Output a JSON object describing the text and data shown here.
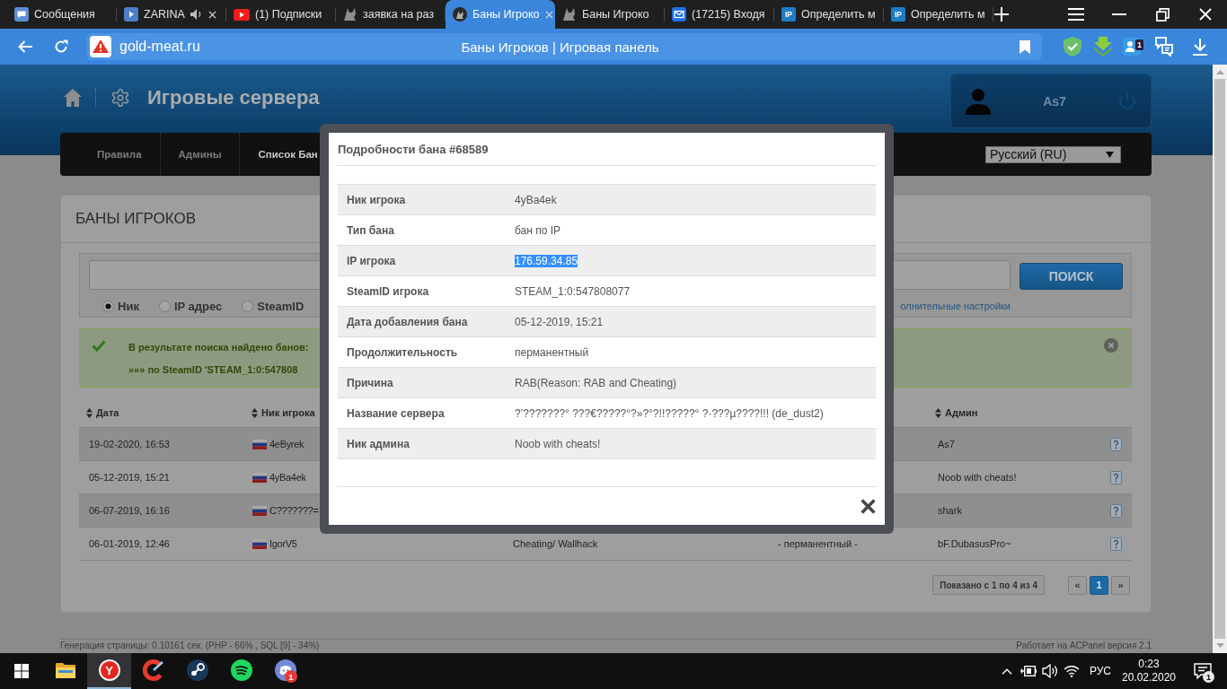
{
  "browser": {
    "tabs": [
      {
        "title": "Сообщения",
        "selected": false,
        "audio": false,
        "closable": false
      },
      {
        "title": "ZARINA",
        "selected": false,
        "audio": true,
        "closable": true
      },
      {
        "title": "(1) Подписки",
        "selected": false,
        "audio": false,
        "closable": false
      },
      {
        "title": "заявка на раз",
        "selected": false,
        "audio": false,
        "closable": false
      },
      {
        "title": "Баны Игроко",
        "selected": true,
        "audio": false,
        "closable": true
      },
      {
        "title": "Баны Игроко",
        "selected": false,
        "audio": false,
        "closable": false
      },
      {
        "title": "(17215) Входя",
        "selected": false,
        "audio": false,
        "closable": false
      },
      {
        "title": "Определить м",
        "selected": false,
        "audio": false,
        "closable": false,
        "icon_text": "IP"
      },
      {
        "title": "Определить м",
        "selected": false,
        "audio": false,
        "closable": false,
        "icon_text": "IP"
      }
    ],
    "url": "gold-meat.ru",
    "page_title": "Баны Игроков | Игровая панель",
    "extension_badge": "1"
  },
  "header": {
    "title": "Игровые сервера",
    "user": "As7"
  },
  "nav": {
    "items": [
      {
        "label": "Правила",
        "selected": false
      },
      {
        "label": "Админы",
        "selected": false
      },
      {
        "label": "Список Бан",
        "selected": true
      }
    ],
    "language": "Русский (RU)"
  },
  "bans": {
    "title": "БАНЫ ИГРОКОВ",
    "search": {
      "options": [
        {
          "label": "Ник",
          "selected": true
        },
        {
          "label": "IP адрес",
          "selected": false
        },
        {
          "label": "SteamID",
          "selected": false
        }
      ],
      "advanced_link": "олнительные настройки",
      "button": "ПОИСК"
    },
    "result": [
      "В результате поиска найдено банов:",
      "»»» по SteamID 'STEAM_1:0:547808"
    ],
    "table": {
      "columns": {
        "date": "Дата",
        "nick": "Ник игрока",
        "admin": "Админ"
      },
      "rows": [
        {
          "date": "19-02-2020, 16:53",
          "nick": "4eByrek",
          "admin": "As7"
        },
        {
          "date": "05-12-2019, 15:21",
          "nick": "4yBa4ek",
          "admin": "Noob with cheats!"
        },
        {
          "date": "06-07-2019, 16:16",
          "nick": "C???????=",
          "admin": "shark"
        },
        {
          "date": "06-01-2019, 12:46",
          "nick": "IgorV5",
          "reason": "Cheating/ Wallhack",
          "duration": "- перманентный -",
          "admin": "bF.DubasusPro~"
        }
      ]
    },
    "pagination": {
      "summary": "Показано с 1 по 4 из 4",
      "prev": "«",
      "pages": [
        {
          "label": "1",
          "selected": true
        }
      ],
      "next": "»"
    }
  },
  "footer": {
    "stats": "Генерация страницы: 0.10161 сек. (PHP - 66% , SQL [9] - 34%)",
    "powered_by": "Работает на ACPanel версия 2.1"
  },
  "modal": {
    "title": "Подробности бана #68589",
    "rows": [
      {
        "label": "Ник игрока",
        "value": "4yBa4ek",
        "highlighted": false
      },
      {
        "label": "Тип бана",
        "value": "бан по IP",
        "highlighted": false
      },
      {
        "label": "IP игрока",
        "value": "176.59.34.85",
        "highlighted": true
      },
      {
        "label": "SteamID игрока",
        "value": "STEAM_1:0:547808077",
        "highlighted": false
      },
      {
        "label": "Дата добавления бана",
        "value": "05-12-2019, 15:21",
        "highlighted": false
      },
      {
        "label": "Продолжительность",
        "value": "перманентный",
        "highlighted": false
      },
      {
        "label": "Причина",
        "value": "RAB(Reason: RAB and Cheating)",
        "highlighted": false
      },
      {
        "label": "Название сервера",
        "value": "?’???????° ???€?????°?»?°?!!?????° ?·???µ????!!! (de_dust2)",
        "highlighted": false
      },
      {
        "label": "Ник админа",
        "value": "Noob with cheats!",
        "highlighted": false
      }
    ]
  },
  "taskbar": {
    "apps": [
      {
        "selected": false
      },
      {
        "selected": true,
        "icon_text": "Y"
      },
      {
        "selected": false
      },
      {
        "selected": false
      },
      {
        "selected": false
      },
      {
        "selected": false,
        "badge": "1"
      }
    ],
    "language": "РУС",
    "time": "0:23",
    "date": "20.02.2020",
    "notifications": "1"
  }
}
